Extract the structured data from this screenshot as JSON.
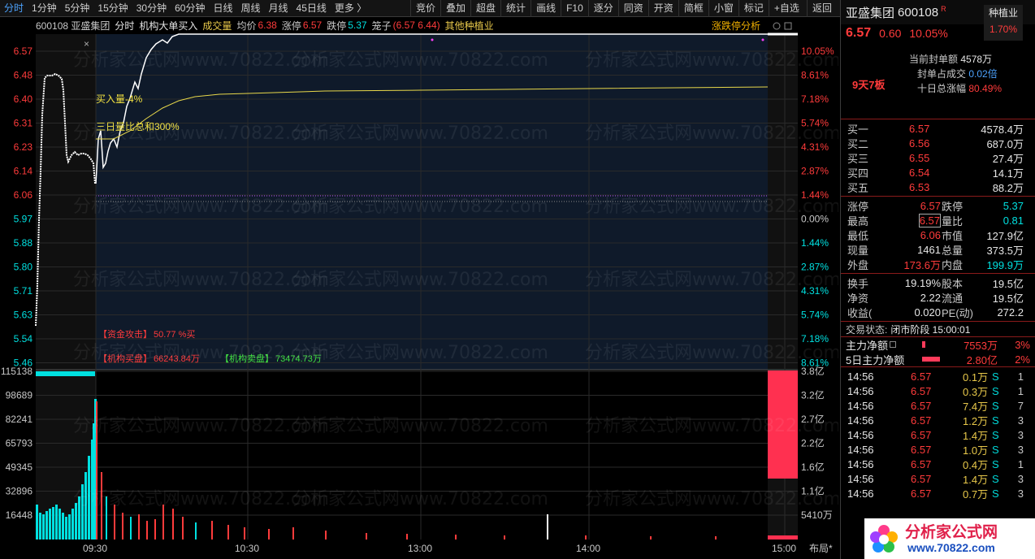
{
  "toolbar": {
    "periods": [
      "分时",
      "1分钟",
      "5分钟",
      "15分钟",
      "30分钟",
      "60分钟",
      "日线",
      "周线",
      "月线",
      "45日线",
      "更多 〉"
    ],
    "tools": [
      "竞价",
      "叠加",
      "超盘",
      "统计",
      "画线",
      "F10",
      "逐分",
      "同资",
      "开资",
      "简框",
      "小窗",
      "标记",
      "+自选",
      "返回"
    ]
  },
  "chart": {
    "code_name": "600108 亚盛集团",
    "mode": "分时",
    "indicator": "机构大单买入",
    "volume_label": "成交量",
    "avg_label": "均价",
    "avg_value": "6.38",
    "limit_up_label": "涨停",
    "limit_up_value": "6.57",
    "limit_down_label": "跌停",
    "limit_down_value": "5.37",
    "cage_label": "笼子",
    "cage_value": "(6.57 6.44)",
    "sector": "其他种植业",
    "analysis_link": "涨跌停分析",
    "price_ticks": [
      "6.57",
      "6.48",
      "6.40",
      "6.31",
      "6.23",
      "6.14",
      "6.06",
      "5.97",
      "5.88",
      "5.80",
      "5.71",
      "5.63",
      "5.54",
      "5.46"
    ],
    "pct_ticks": [
      "10.05%",
      "8.61%",
      "7.18%",
      "5.74%",
      "4.31%",
      "2.87%",
      "1.44%",
      "0.00%",
      "1.44%",
      "2.87%",
      "4.31%",
      "5.74%",
      "7.18%",
      "8.61%"
    ],
    "vol_ticks": [
      "115138",
      "98689",
      "82241",
      "65793",
      "49345",
      "32896",
      "16448"
    ],
    "amount_ticks": [
      "3.8亿",
      "3.2亿",
      "2.7亿",
      "2.2亿",
      "1.6亿",
      "1.1亿",
      "5410万"
    ],
    "time_ticks": [
      "09:30",
      "10:30",
      "13:00",
      "14:00",
      "15:00"
    ],
    "layout_label": "布局*",
    "annot_buy_volume": "买入量-4%",
    "annot_three_day": "三日量比总和300%",
    "fund_attack_label": "【资金攻击】",
    "fund_attack_value": "50.77 %买",
    "inst_buy_label": "【机构买盘】",
    "inst_buy_value": "66243.84万",
    "inst_sell_label": "【机构卖盘】",
    "inst_sell_value": "73474.73万",
    "watermark": "分析家公式网www.70822.com"
  },
  "panel": {
    "name": "亚盛集团",
    "code": "600108",
    "badge": "R",
    "sector": "种植业",
    "sector_pct": "1.70%",
    "price": "6.57",
    "change": "0.60",
    "change_pct": "10.05%",
    "seal_label": "当前封单额",
    "seal_value": "4578万",
    "seal_ratio_label": "封单占成交",
    "seal_ratio_value": "0.02倍",
    "ten_day_label": "十日总涨幅",
    "ten_day_value": "80.49%",
    "streak": "9天7板",
    "bids": [
      {
        "label": "买一",
        "price": "6.57",
        "vol": "4578.4万"
      },
      {
        "label": "买二",
        "price": "6.56",
        "vol": "687.0万"
      },
      {
        "label": "买三",
        "price": "6.55",
        "vol": "27.4万"
      },
      {
        "label": "买四",
        "price": "6.54",
        "vol": "14.1万"
      },
      {
        "label": "买五",
        "price": "6.53",
        "vol": "88.2万"
      }
    ],
    "stats": [
      {
        "l1": "涨停",
        "v1": "6.57",
        "c1": "red",
        "l2": "跌停",
        "v2": "5.37",
        "c2": "green"
      },
      {
        "l1": "最高",
        "v1": "6.57",
        "c1": "red",
        "l2": "量比",
        "v2": "0.81",
        "c2": "green"
      },
      {
        "l1": "最低",
        "v1": "6.06",
        "c1": "red",
        "l2": "市值",
        "v2": "127.9亿",
        "c2": "white"
      },
      {
        "l1": "现量",
        "v1": "1461",
        "c1": "white",
        "l2": "总量",
        "v2": "373.5万",
        "c2": "white"
      },
      {
        "l1": "外盘",
        "v1": "173.6万",
        "c1": "red",
        "l2": "内盘",
        "v2": "199.9万",
        "c2": "green"
      }
    ],
    "stats2": [
      {
        "l1": "换手",
        "v1": "19.19%",
        "l2": "股本",
        "v2": "19.5亿"
      },
      {
        "l1": "净资",
        "v1": "2.22",
        "l2": "流通",
        "v2": "19.5亿"
      },
      {
        "l1": "收益(",
        "v1": "0.020",
        "l2": "PE(动)",
        "v2": "272.2"
      }
    ],
    "status_label": "交易状态:",
    "status_value": "闭市阶段 15:00:01",
    "main_net_label": "主力净额",
    "main_net_value": "7553万",
    "main_net_pct": "3%",
    "five_day_label": "5日主力净额",
    "five_day_value": "2.80亿",
    "five_day_pct": "2%",
    "ticks": [
      {
        "time": "14:56",
        "price": "6.57",
        "vol": "0.1万",
        "side": "S",
        "n": "1"
      },
      {
        "time": "14:56",
        "price": "6.57",
        "vol": "0.3万",
        "side": "S",
        "n": "1"
      },
      {
        "time": "14:56",
        "price": "6.57",
        "vol": "7.4万",
        "side": "S",
        "n": "7"
      },
      {
        "time": "14:56",
        "price": "6.57",
        "vol": "1.2万",
        "side": "S",
        "n": "3"
      },
      {
        "time": "14:56",
        "price": "6.57",
        "vol": "1.4万",
        "side": "S",
        "n": "3"
      },
      {
        "time": "14:56",
        "price": "6.57",
        "vol": "1.0万",
        "side": "S",
        "n": "3"
      },
      {
        "time": "14:56",
        "price": "6.57",
        "vol": "0.4万",
        "side": "S",
        "n": "1"
      },
      {
        "time": "14:56",
        "price": "6.57",
        "vol": "1.4万",
        "side": "S",
        "n": "3"
      },
      {
        "time": "14:56",
        "price": "6.57",
        "vol": "0.7万",
        "side": "S",
        "n": "3"
      }
    ],
    "logo_text": "分析家公式网",
    "logo_url": "www.70822.com"
  },
  "colors": {
    "up": "#ff3b3b",
    "down": "#00e0e0",
    "price_line": "#ffffff",
    "avg_line": "#e8d84a",
    "grid": "#2a2a2a"
  }
}
